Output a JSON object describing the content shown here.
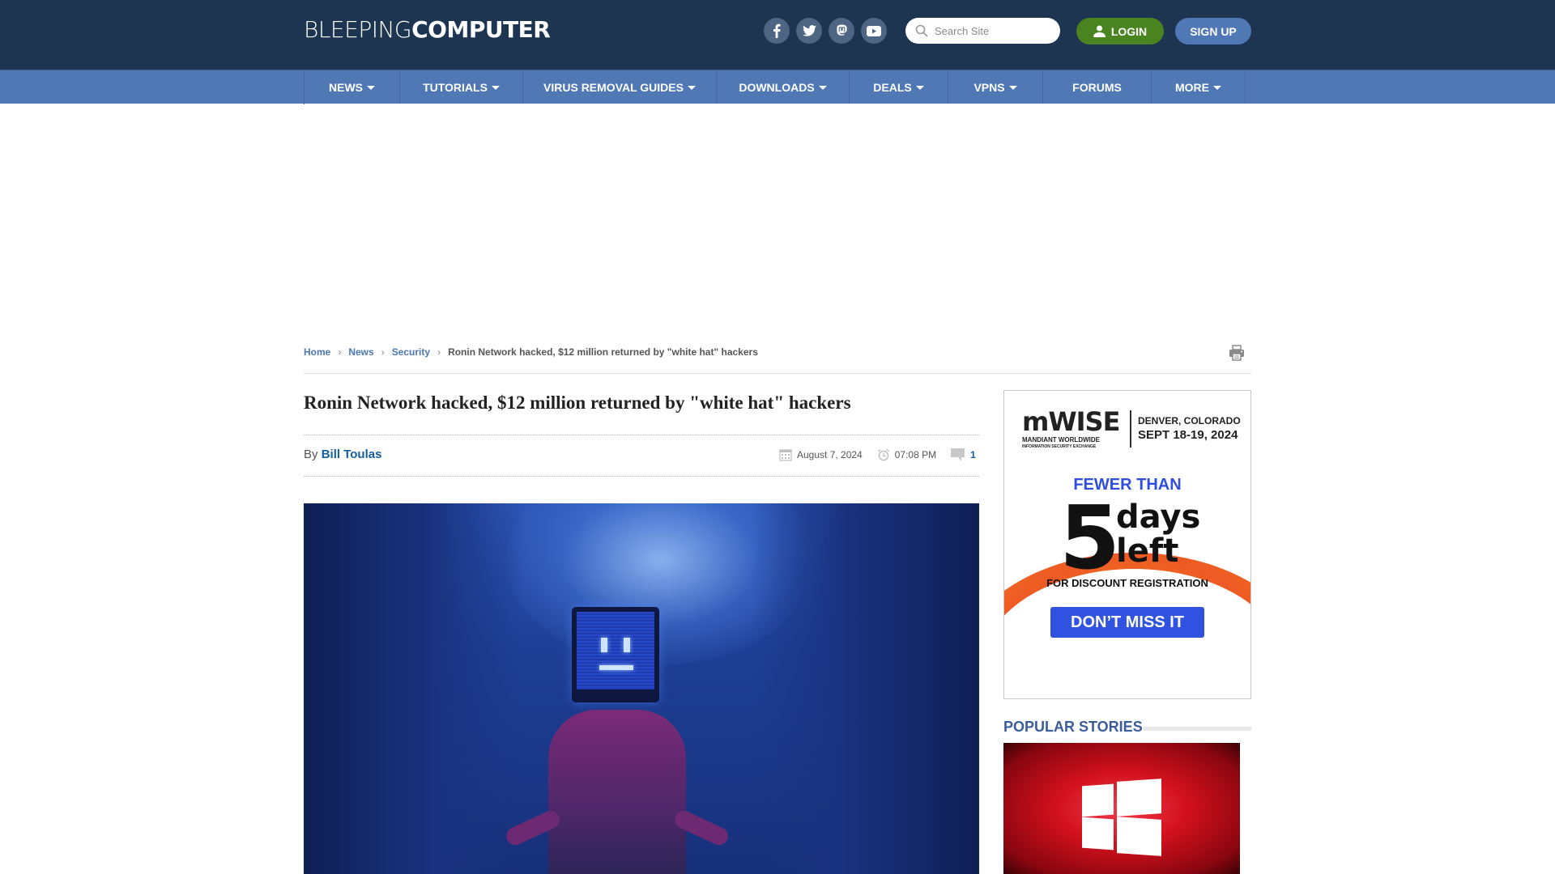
{
  "header": {
    "logo_light": "BLEEPING",
    "logo_bold": "COMPUTER",
    "social": [
      {
        "name": "facebook",
        "icon": "facebook-icon"
      },
      {
        "name": "twitter",
        "icon": "twitter-icon"
      },
      {
        "name": "mastodon",
        "icon": "mastodon-icon"
      },
      {
        "name": "youtube",
        "icon": "youtube-icon"
      }
    ],
    "search_placeholder": "Search Site",
    "login_label": "LOGIN",
    "signup_label": "SIGN UP",
    "colors": {
      "header_bg": "#1e3551",
      "nav_bg": "#5078b5",
      "login_bg": "#498421",
      "signup_bg": "#5078b5"
    }
  },
  "nav": {
    "items": [
      {
        "label": "NEWS",
        "dropdown": true
      },
      {
        "label": "TUTORIALS",
        "dropdown": true
      },
      {
        "label": "VIRUS REMOVAL GUIDES",
        "dropdown": true
      },
      {
        "label": "DOWNLOADS",
        "dropdown": true
      },
      {
        "label": "DEALS",
        "dropdown": true
      },
      {
        "label": "VPNS",
        "dropdown": true
      },
      {
        "label": "FORUMS",
        "dropdown": false
      },
      {
        "label": "MORE",
        "dropdown": true
      }
    ]
  },
  "breadcrumb": {
    "items": [
      "Home",
      "News",
      "Security"
    ],
    "current": "Ronin Network hacked, $12 million returned by \"white hat\" hackers"
  },
  "article": {
    "title": "Ronin Network hacked, $12 million returned by \"white hat\" hackers",
    "by_label": "By",
    "author": "Bill Toulas",
    "date": "August 7, 2024",
    "time": "07:08 PM",
    "comments": "1"
  },
  "ad": {
    "brand": "mWISE",
    "brand_sub": "MANDIANT WORLDWIDE",
    "brand_sub2": "INFORMATION SECURITY EXCHANGE",
    "location": "DENVER, COLORADO",
    "dates": "SEPT 18-19, 2024",
    "headline": "FEWER THAN",
    "number": "5",
    "days": "days",
    "left": "left",
    "subline": "FOR DISCOUNT REGISTRATION",
    "cta": "DON’T MISS IT"
  },
  "sidebar": {
    "popular_title": "POPULAR STORIES"
  }
}
